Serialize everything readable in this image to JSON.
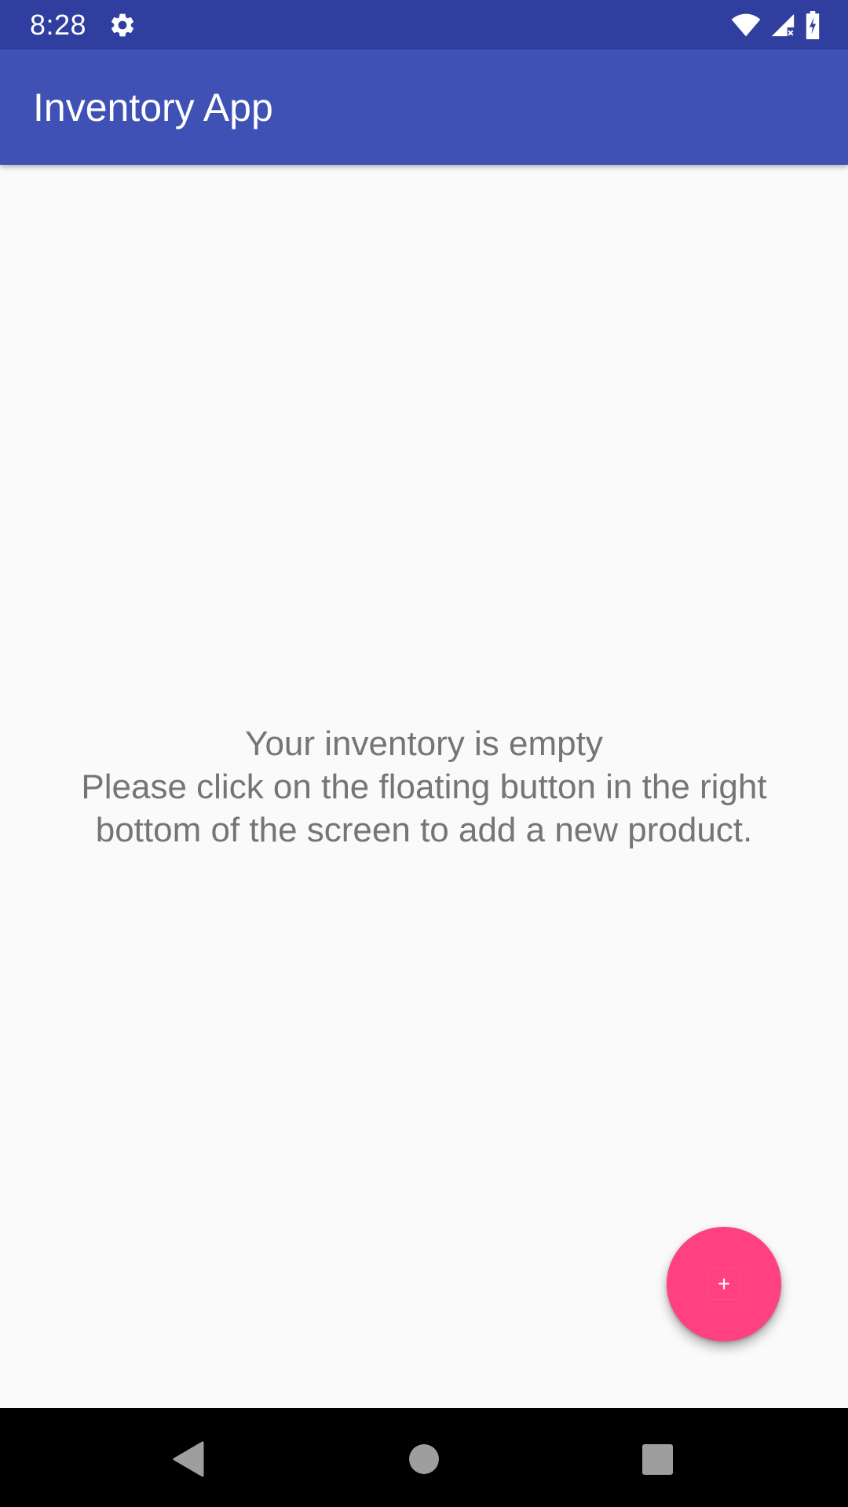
{
  "status_bar": {
    "time": "8:28",
    "icons": [
      "settings-gear-icon",
      "wifi-icon",
      "signal-icon",
      "battery-icon"
    ]
  },
  "app_bar": {
    "title": "Inventory App",
    "color": "#3f51b5"
  },
  "empty_state": {
    "line1": "Your inventory is empty",
    "line2": "Please click on the floating button in the right",
    "line3": "bottom of the screen to add a new product."
  },
  "fab": {
    "icon": "plus-icon",
    "symbol": "+",
    "color": "#ff4081"
  },
  "nav_bar": {
    "icons": [
      "back-icon",
      "home-icon",
      "recents-icon"
    ]
  }
}
